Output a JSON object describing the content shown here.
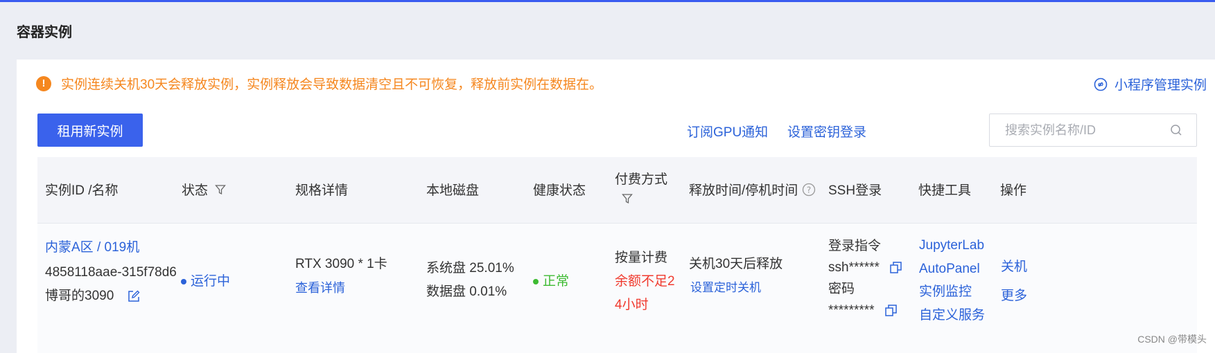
{
  "page": {
    "title": "容器实例"
  },
  "alert": {
    "text": "实例连续关机30天会释放实例，实例释放会导致数据清空且不可恢复，释放前实例在数据在。",
    "icon": "warning-icon"
  },
  "mini_program_link": "小程序管理实例",
  "toolbar": {
    "rent_button": "租用新实例",
    "subscribe_gpu": "订阅GPU通知",
    "set_key_login": "设置密钥登录",
    "search_placeholder": "搜索实例名称/ID"
  },
  "table": {
    "headers": {
      "id_name": "实例ID /名称",
      "status": "状态",
      "spec": "规格详情",
      "disk": "本地磁盘",
      "health": "健康状态",
      "billing": "付费方式",
      "release_time": "释放时间/停机时间",
      "ssh": "SSH登录",
      "tools": "快捷工具",
      "actions": "操作"
    },
    "row": {
      "region": "内蒙A区 / 019机",
      "instance_id": "4858118aae-315f78d6",
      "name": "博哥的3090",
      "status": "运行中",
      "spec": "RTX 3090 * 1卡",
      "spec_detail_link": "查看详情",
      "disk_system": "系统盘 25.01%",
      "disk_data": "数据盘 0.01%",
      "health": "正常",
      "billing": "按量计费",
      "billing_warning_line1": "余额不足2",
      "billing_warning_line2": "4小时",
      "release": "关机30天后释放",
      "timer_link": "设置定时关机",
      "ssh_cmd_label": "登录指令",
      "ssh_cmd_value": "ssh******",
      "ssh_pwd_label": "密码",
      "ssh_pwd_value": "*********",
      "tools": [
        "JupyterLab",
        "AutoPanel",
        "实例监控",
        "自定义服务"
      ],
      "action_shutdown": "关机",
      "action_more": "更多"
    }
  },
  "watermark": "CSDN @带模头",
  "colors": {
    "accent": "#3a62ec",
    "link": "#2b62d9",
    "warning": "#f5871f",
    "success": "#3dbb32",
    "danger": "#f03a2e"
  }
}
